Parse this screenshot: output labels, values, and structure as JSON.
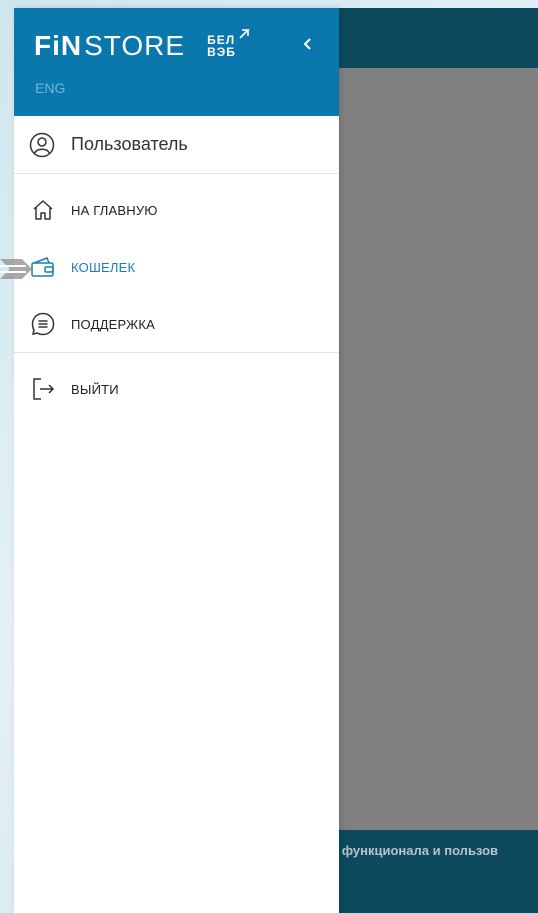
{
  "app": {
    "footer_text": "ю функционала и пользов"
  },
  "drawer": {
    "logo": {
      "fin": "FiN",
      "store": "STORE",
      "bank_line1": "БЕЛ",
      "bank_line2": "ВЭБ"
    },
    "language": "ENG",
    "user": {
      "label": "Пользователь",
      "icon": "user-circle-icon"
    },
    "menu": [
      {
        "label": "НА ГЛАВНУЮ",
        "icon": "home-icon",
        "active": false
      },
      {
        "label": "КОШЕЛЕК",
        "icon": "wallet-icon",
        "active": true
      },
      {
        "label": "ПОДДЕРЖКА",
        "icon": "chat-icon",
        "active": false
      },
      {
        "label": "ВЫЙТИ",
        "icon": "logout-icon",
        "active": false
      }
    ]
  },
  "colors": {
    "header": "#0a78ad",
    "app_bar": "#0d4a5e",
    "overlay": "#808080",
    "active": "#1a7fb0"
  }
}
